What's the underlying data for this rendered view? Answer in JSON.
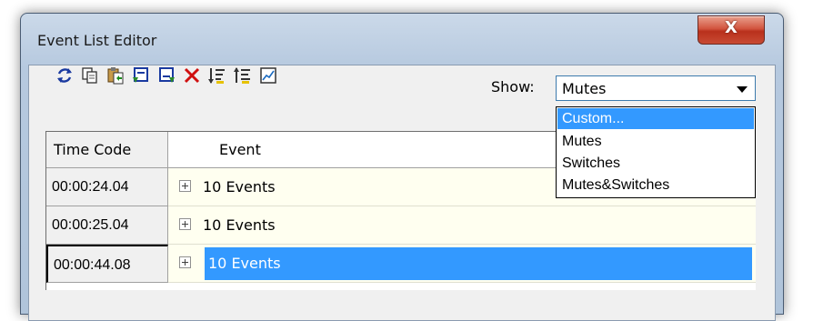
{
  "window": {
    "title": "Event List Editor",
    "close_label": "X"
  },
  "toolbar": {
    "buttons": [
      {
        "icon": "refresh-icon"
      },
      {
        "icon": "copy-icon"
      },
      {
        "icon": "paste-icon"
      },
      {
        "icon": "insert-before-icon"
      },
      {
        "icon": "insert-after-icon"
      },
      {
        "icon": "delete-icon"
      },
      {
        "icon": "sort-icon"
      },
      {
        "icon": "indent-icon"
      },
      {
        "icon": "graph-icon"
      }
    ],
    "show_label": "Show:",
    "show_value": "Mutes"
  },
  "dropdown": {
    "options": [
      "Custom...",
      "Mutes",
      "Switches",
      "Mutes&Switches"
    ],
    "highlighted": "Custom..."
  },
  "grid": {
    "columns": [
      "Time Code",
      "Event"
    ],
    "rows": [
      {
        "time_code": "00:00:24.04",
        "event": "10 Events"
      },
      {
        "time_code": "00:00:25.04",
        "event": "10 Events"
      },
      {
        "time_code": "00:00:44.08",
        "event": "10 Events"
      }
    ]
  },
  "colors": {
    "selection": "#3399ff",
    "close_button": "#c84a33",
    "title_bar": "#b6c9df"
  }
}
